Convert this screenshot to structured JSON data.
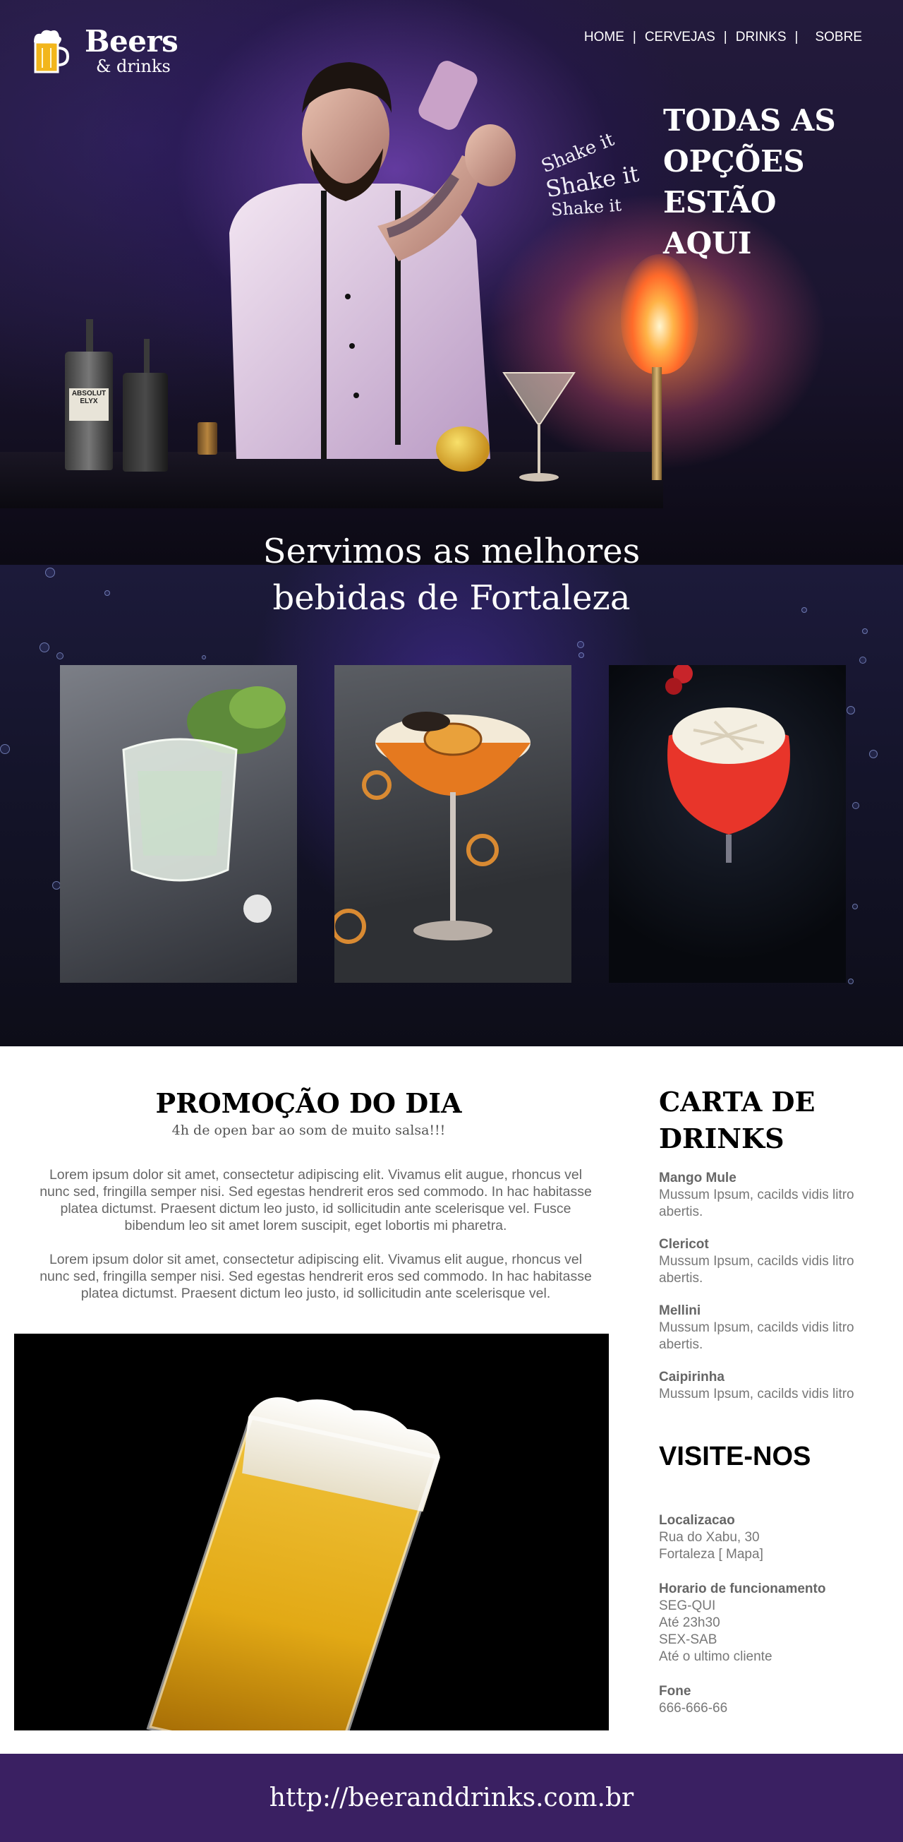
{
  "brand": {
    "name": "Beers",
    "subtitle": "& drinks"
  },
  "nav": {
    "items": [
      {
        "label": "HOME"
      },
      {
        "label": "CERVEJAS"
      },
      {
        "label": "DRINKS"
      },
      {
        "label": "SOBRE"
      }
    ],
    "separator": "|"
  },
  "hero": {
    "tagline": [
      "TODAS AS",
      "OPÇÕES",
      "ESTÃO AQUI"
    ],
    "shake_text": [
      "Shake it",
      "Shake it",
      "Shake it"
    ],
    "bottle_label": "ABSOLUT ELYX"
  },
  "drinks_section": {
    "title_line1": "Servimos as melhores",
    "title_line2": "bebidas de Fortaleza"
  },
  "promo": {
    "title": "PROMOÇÃO DO DIA",
    "subtitle": "4h de open bar ao som de muito salsa!!!",
    "paragraph1": [
      "Lorem ipsum dolor sit amet, consectetur adipiscing elit. Vivamus elit augue, rhoncus vel",
      "nunc sed, fringilla semper nisi. Sed egestas hendrerit eros sed commodo. In hac habitasse",
      "platea dictumst. Praesent dictum leo justo, id sollicitudin ante scelerisque vel. Fusce",
      "bibendum leo sit amet lorem suscipit, eget lobortis mi pharetra."
    ],
    "paragraph2": [
      "Lorem ipsum dolor sit amet, consectetur adipiscing elit. Vivamus elit augue, rhoncus vel",
      "nunc sed, fringilla semper nisi. Sed egestas hendrerit eros sed commodo. In hac habitasse",
      "platea dictumst. Praesent dictum leo justo, id sollicitudin ante scelerisque vel."
    ]
  },
  "menu": {
    "title_line1": "CARTA DE",
    "title_line2": "DRINKS",
    "items": [
      {
        "name": "Mango Mule",
        "desc_line1": "Mussum Ipsum, cacilds vidis litro",
        "desc_line2": "abertis."
      },
      {
        "name": "Clericot",
        "desc_line1": "Mussum Ipsum, cacilds vidis litro",
        "desc_line2": "abertis."
      },
      {
        "name": "Mellini",
        "desc_line1": "Mussum Ipsum, cacilds vidis litro",
        "desc_line2": "abertis."
      },
      {
        "name": "Caipirinha",
        "desc_line1": "Mussum Ipsum, cacilds vidis litro",
        "desc_line2": ""
      }
    ]
  },
  "visit": {
    "title": "VISITE-NOS",
    "location_label": "Localizacao",
    "location_lines": [
      "Rua do Xabu, 30",
      "Fortaleza [ Mapa]"
    ],
    "hours_label": "Horario de funcionamento",
    "hours_lines": [
      "SEG-QUI",
      "Até 23h30",
      "SEX-SAB",
      "Até o ultimo cliente"
    ],
    "phone_label": "Fone",
    "phone": "666-666-66"
  },
  "footer": {
    "url": "http://beeranddrinks.com.br"
  },
  "colors": {
    "footer_bg": "#3a2062",
    "hero_bg": "#231a3c",
    "heading": "#000000",
    "body_text": "#666666"
  }
}
